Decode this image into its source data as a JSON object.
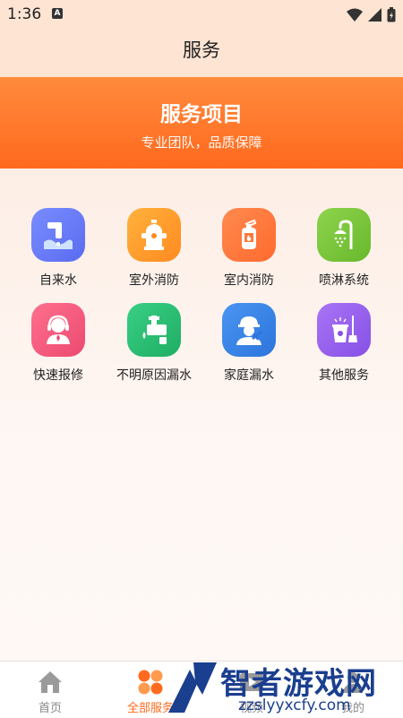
{
  "status": {
    "time": "1:36",
    "notif_icon": "A"
  },
  "header": {
    "title": "服务"
  },
  "banner": {
    "title": "服务项目",
    "subtitle": "专业团队，品质保障"
  },
  "services": [
    {
      "label": "自来水",
      "icon": "water-pipe-icon",
      "color": "#6b7cf5"
    },
    {
      "label": "室外消防",
      "icon": "fire-hydrant-icon",
      "color": "#ff9a2e"
    },
    {
      "label": "室内消防",
      "icon": "fire-extinguisher-icon",
      "color": "#ff7a3a"
    },
    {
      "label": "喷淋系统",
      "icon": "shower-icon",
      "color": "#7cc43c"
    },
    {
      "label": "快速报修",
      "icon": "customer-service-icon",
      "color": "#f2577d"
    },
    {
      "label": "不明原因漏水",
      "icon": "leak-icon",
      "color": "#2bbd73"
    },
    {
      "label": "家庭漏水",
      "icon": "repairman-icon",
      "color": "#3a86e8"
    },
    {
      "label": "其他服务",
      "icon": "cleaning-icon",
      "color": "#9a5ff0"
    }
  ],
  "nav": [
    {
      "label": "首页",
      "icon": "home-icon"
    },
    {
      "label": "全部服务",
      "icon": "all-services-icon",
      "active": true
    },
    {
      "label": "视频",
      "icon": "video-icon"
    },
    {
      "label": "我的",
      "icon": "profile-icon"
    }
  ],
  "watermark": {
    "text": "智者游戏网",
    "url": "zzslyyxcfy.com"
  }
}
